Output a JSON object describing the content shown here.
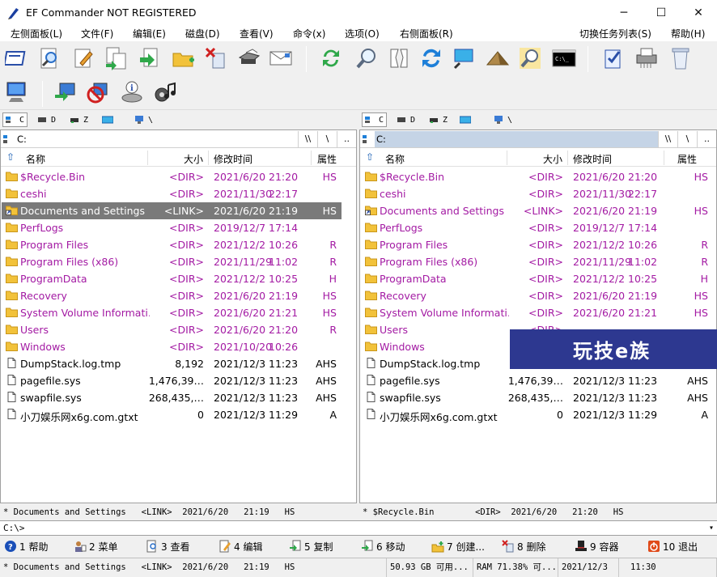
{
  "window": {
    "title": "EF Commander NOT REGISTERED",
    "minimize": "─",
    "maximize": "☐",
    "close": "✕"
  },
  "menu": [
    "左侧面板(L)",
    "文件(F)",
    "编辑(E)",
    "磁盘(D)",
    "查看(V)",
    "命令(x)",
    "选项(O)",
    "右侧面板(R)",
    "切换任务列表(S)",
    "帮助(H)"
  ],
  "toolbar1": [
    "open-icon",
    "view-icon",
    "edit-icon",
    "copy-icon",
    "move-icon",
    "new-folder-icon",
    "delete-icon",
    "print-icon",
    "email-icon",
    "sync-icon",
    "find-icon",
    "split-icon",
    "refresh-icon",
    "network-icon",
    "pyramid-icon",
    "search-icon",
    "console-icon",
    "checklist-icon",
    "shredder-icon",
    "recycle-bin-icon"
  ],
  "toolbar2": [
    "computer-icon",
    "connect-icon",
    "disconnect-icon",
    "info-icon",
    "music-icon"
  ],
  "drives": [
    {
      "letter": "C",
      "icon": "hard-drive-icon"
    },
    {
      "letter": "D",
      "icon": "printer-drive-icon"
    },
    {
      "letter": "Z",
      "icon": "removable-drive-icon"
    },
    {
      "letter": "",
      "icon": "network-drive-icon"
    },
    {
      "letter": "\\",
      "icon": "network-root-icon"
    }
  ],
  "columns": {
    "name": "名称",
    "size": "大小",
    "modified": "修改时间",
    "attr": "属性"
  },
  "left_panel": {
    "path": "C:",
    "path_buttons": [
      "\\\\",
      "\\",
      ".."
    ],
    "selected_index": 2,
    "files": [
      {
        "name": "$Recycle.Bin",
        "size": "<DIR>",
        "date": "2021/6/20",
        "time": "21:20",
        "attr": "HS",
        "type": "dir"
      },
      {
        "name": "ceshi",
        "size": "<DIR>",
        "date": "2021/11/30",
        "time": "22:17",
        "attr": "",
        "type": "dir"
      },
      {
        "name": "Documents and Settings",
        "size": "<LINK>",
        "date": "2021/6/20",
        "time": "21:19",
        "attr": "HS",
        "type": "link"
      },
      {
        "name": "PerfLogs",
        "size": "<DIR>",
        "date": "2019/12/7",
        "time": "17:14",
        "attr": "",
        "type": "dir"
      },
      {
        "name": "Program Files",
        "size": "<DIR>",
        "date": "2021/12/2",
        "time": "10:26",
        "attr": "R",
        "type": "dir"
      },
      {
        "name": "Program Files (x86)",
        "size": "<DIR>",
        "date": "2021/11/29",
        "time": "11:02",
        "attr": "R",
        "type": "dir"
      },
      {
        "name": "ProgramData",
        "size": "<DIR>",
        "date": "2021/12/2",
        "time": "10:25",
        "attr": "H",
        "type": "dir"
      },
      {
        "name": "Recovery",
        "size": "<DIR>",
        "date": "2021/6/20",
        "time": "21:19",
        "attr": "HS",
        "type": "dir"
      },
      {
        "name": "System Volume Informati…",
        "size": "<DIR>",
        "date": "2021/6/20",
        "time": "21:21",
        "attr": "HS",
        "type": "dir"
      },
      {
        "name": "Users",
        "size": "<DIR>",
        "date": "2021/6/20",
        "time": "21:20",
        "attr": "R",
        "type": "dir"
      },
      {
        "name": "Windows",
        "size": "<DIR>",
        "date": "2021/10/20",
        "time": "10:26",
        "attr": "",
        "type": "dir"
      },
      {
        "name": "DumpStack.log.tmp",
        "size": "8,192",
        "date": "2021/12/3",
        "time": "11:23",
        "attr": "AHS",
        "type": "file"
      },
      {
        "name": "pagefile.sys",
        "size": "1,476,39…",
        "date": "2021/12/3",
        "time": "11:23",
        "attr": "AHS",
        "type": "file"
      },
      {
        "name": "swapfile.sys",
        "size": "268,435,…",
        "date": "2021/12/3",
        "time": "11:23",
        "attr": "AHS",
        "type": "file"
      },
      {
        "name": "小刀娱乐网x6g.com.gtxt",
        "size": "0",
        "date": "2021/12/3",
        "time": "11:29",
        "attr": "A",
        "type": "file"
      }
    ]
  },
  "right_panel": {
    "path": "C:",
    "path_buttons": [
      "\\\\",
      "\\",
      ".."
    ],
    "files": [
      {
        "name": "$Recycle.Bin",
        "size": "<DIR>",
        "date": "2021/6/20",
        "time": "21:20",
        "attr": "HS",
        "type": "dir"
      },
      {
        "name": "ceshi",
        "size": "<DIR>",
        "date": "2021/11/30",
        "time": "22:17",
        "attr": "",
        "type": "dir"
      },
      {
        "name": "Documents and Settings",
        "size": "<LINK>",
        "date": "2021/6/20",
        "time": "21:19",
        "attr": "HS",
        "type": "link"
      },
      {
        "name": "PerfLogs",
        "size": "<DIR>",
        "date": "2019/12/7",
        "time": "17:14",
        "attr": "",
        "type": "dir"
      },
      {
        "name": "Program Files",
        "size": "<DIR>",
        "date": "2021/12/2",
        "time": "10:26",
        "attr": "R",
        "type": "dir"
      },
      {
        "name": "Program Files (x86)",
        "size": "<DIR>",
        "date": "2021/11/29",
        "time": "11:02",
        "attr": "R",
        "type": "dir"
      },
      {
        "name": "ProgramData",
        "size": "<DIR>",
        "date": "2021/12/2",
        "time": "10:25",
        "attr": "H",
        "type": "dir"
      },
      {
        "name": "Recovery",
        "size": "<DIR>",
        "date": "2021/6/20",
        "time": "21:19",
        "attr": "HS",
        "type": "dir"
      },
      {
        "name": "System Volume Informati…",
        "size": "<DIR>",
        "date": "2021/6/20",
        "time": "21:21",
        "attr": "HS",
        "type": "dir"
      },
      {
        "name": "Users",
        "size": "<DIR>",
        "date": "",
        "time": "",
        "attr": "",
        "type": "dir"
      },
      {
        "name": "Windows",
        "size": "",
        "date": "",
        "time": "",
        "attr": "",
        "type": "dir"
      },
      {
        "name": "DumpStack.log.tmp",
        "size": "",
        "date": "",
        "time": "",
        "attr": "",
        "type": "file"
      },
      {
        "name": "pagefile.sys",
        "size": "1,476,39…",
        "date": "2021/12/3",
        "time": "11:23",
        "attr": "AHS",
        "type": "file"
      },
      {
        "name": "swapfile.sys",
        "size": "268,435,…",
        "date": "2021/12/3",
        "time": "11:23",
        "attr": "AHS",
        "type": "file"
      },
      {
        "name": "小刀娱乐网x6g.com.gtxt",
        "size": "0",
        "date": "2021/12/3",
        "time": "11:29",
        "attr": "A",
        "type": "file"
      }
    ]
  },
  "status_left": "* Documents and Settings   <LINK>  2021/6/20   21:19   HS",
  "status_right": "* $Recycle.Bin        <DIR>  2021/6/20   21:20   HS",
  "command_line": "C:\\>",
  "fkeys": [
    {
      "label": "1 帮助",
      "icon": "help-icon"
    },
    {
      "label": "2 菜单",
      "icon": "menu-icon"
    },
    {
      "label": "3 查看",
      "icon": "view-icon"
    },
    {
      "label": "4 编辑",
      "icon": "edit-icon"
    },
    {
      "label": "5 复制",
      "icon": "copy-icon"
    },
    {
      "label": "6 移动",
      "icon": "move-icon"
    },
    {
      "label": "7 创建...",
      "icon": "create-icon"
    },
    {
      "label": "8 删除",
      "icon": "delete-icon"
    },
    {
      "label": "9 容器",
      "icon": "container-icon"
    },
    {
      "label": "10 退出",
      "icon": "exit-icon"
    }
  ],
  "bottom_status": {
    "selection": "* Documents and Settings   <LINK>  2021/6/20   21:19   HS",
    "free_space": "50.93 GB 可用...",
    "ram": "RAM 71.38% 可...",
    "date": "2021/12/3",
    "time": "11:30"
  },
  "watermark": "玩技e族",
  "colors": {
    "dir": "#a31aa3",
    "selected_row": "#7a7a7a",
    "active_path": "#c5d4e6",
    "watermark_bg": "#2d3890"
  }
}
